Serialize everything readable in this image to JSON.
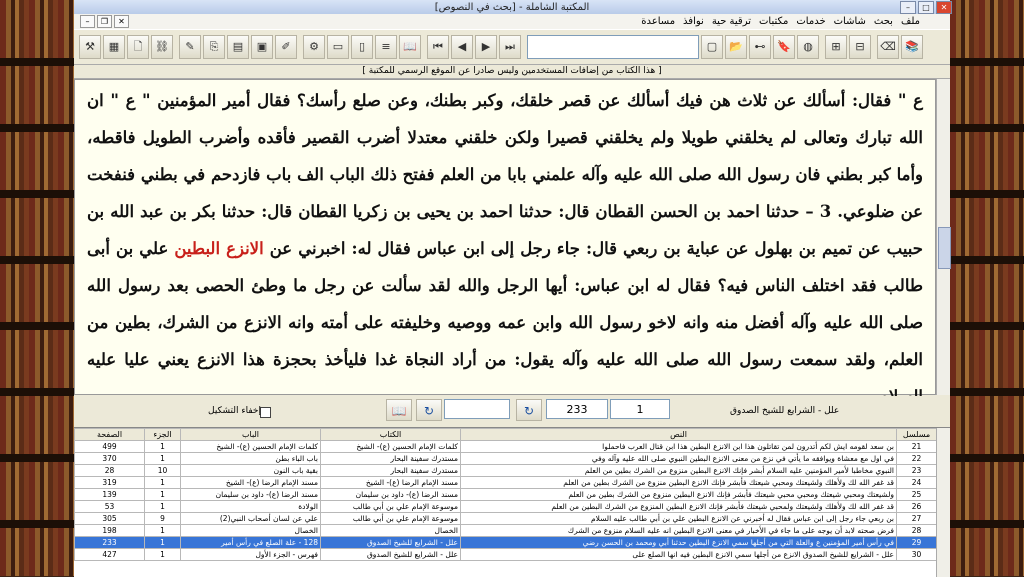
{
  "window_title": "المكتبة الشاملة - [بحث في النصوص]",
  "menu": [
    "ملف",
    "بحث",
    "شاشات",
    "خدمات",
    "مكتبات",
    "ترقية حية",
    "نوافذ",
    "مساعدة"
  ],
  "notice": "[ هذا الكتاب من إضافات المستخدمين وليس صادرا عن الموقع الرسمي للمكتبة ]",
  "reader": {
    "p1": "ع \" فقال: أسألك عن ثلاث هن فيك أسألك عن قصر خلقك، وكبر بطنك، وعن صلع رأسك؟ فقال أمير المؤمنين \" ع \" ان الله تبارك وتعالى لم يخلقني طويلا ولم يخلقني قصيرا ولكن خلقني معتدلا أضرب القصير فأقده وأضرب الطويل فاقطه، وأما كبر بطني فان رسول الله صلى الله عليه وآله علمني بابا من العلم ففتح ذلك الباب الف باب فازدحم في بطني فنفخت عن ضلوعي. 3 – حدثنا احمد بن الحسن القطان قال: حدثنا احمد بن يحيى بن زكريا القطان قال: حدثنا بكر بن عبد الله بن حبيب عن تميم بن بهلول عن عباية بن ربعي قال: جاء رجل إلى ابن عباس فقال له: اخبرني عن",
    "highlight": "الانزع البطين",
    "p2": " علي بن أبى طالب فقد اختلف الناس فيه؟ فقال له ابن عباس: أيها الرجل والله لقد سألت عن رجل ما وطئ الحصى بعد رسول الله صلى الله عليه وآله أفضل منه وانه لاخو رسول الله وابن عمه ووصيه وخليفته على أمته وانه الانزع من الشرك، بطين من العلم، ولقد سمعت رسول الله صلى الله عليه وآله يقول: من أراد النجاة غدا فليأخذ بحجزة هذا الانزع يعني عليا عليه السلام."
  },
  "search": {
    "book_label": "علل - الشرايع للشيخ الصدوق",
    "field_part": "1",
    "field_page": "233",
    "hide_label": "إخفاء التشكيل"
  },
  "table": {
    "headers": [
      "مسلسل",
      "النص",
      "الكتاب",
      "الباب",
      "الجزء",
      "الصفحة"
    ],
    "rows": [
      [
        "21",
        "بن سعد لقومه ايش لكم أتدرون لمن تقاتلون هذا ابن الانزع البطين هذا ابن قتال العرب فاحملوا",
        "كلمات الإمام الحسين (ع)- الشيخ",
        "كلمات الإمام الحسين (ع)- الشيخ",
        "1",
        "499"
      ],
      [
        "22",
        "في اول مع معشاة ويوافقه ما يأتي في نزع من معنى الانزع البطين النبوي صلى الله عليه وآله وفي",
        "مستدرك سفينة البحار",
        "باب الباء بطن",
        "1",
        "370"
      ],
      [
        "23",
        "النبوي مخاطبا لأمير المؤمنين عليه السلام أبشر فإنك الانزع البطين منزوع من الشرك بطين من العلم",
        "مستدرك سفينة البحار",
        "بقية باب النون",
        "10",
        "28"
      ],
      [
        "24",
        "قد غفر الله لك ولأهلك ولشيعتك ومحبي شيعتك فأبشر فإنك الانزع البطين منزوع من الشرك بطين من العلم",
        "مسند الإمام الرضا (ع)- الشيخ",
        "مسند الإمام الرضا (ع)- الشيخ",
        "1",
        "319"
      ],
      [
        "25",
        "ولشيعتك ومحبي شيعتك ومحبي محبي شيعتك فأبشر فإنك الانزع البطين منزوع من الشرك بطين من العلم",
        "مسند الرضا (ع)- داود بن سليمان",
        "مسند الرضا (ع)- داود بن سليمان",
        "1",
        "139"
      ],
      [
        "26",
        "قد غفر الله لك ولأهلك ولشيعتك ولمحبي شيعتك فأبشر فإنك الانزع البطين المنزوع من الشرك البطين من العلم",
        "موسوعة الإمام علي بن أبي طالب",
        "الولادة",
        "1",
        "53"
      ],
      [
        "27",
        "بن ربعي جاء رجل إلى ابن عباس فقال له أخبرني عن الانزع البطين علي بن أبي طالب عليه السلام",
        "موسوعة الإمام علي بن أبي طالب",
        "علي عن لسان أصحاب النبي(2)",
        "9",
        "305"
      ],
      [
        "28",
        "فرض صحته لابد أن يوجه على ما جاء في الأخبار في معنى الانزع البطين انه عليه السلام منزوع من الشرك",
        "الخصال",
        "الخصال",
        "1",
        "198"
      ],
      [
        "29",
        "في رأس أمير المؤمنين ع والعلة التي من أجلها سمي الانزع البطين حدثنا أبي ومحمد بن الحسن رضي",
        "علل - الشرايع للشيخ الصدوق",
        "128 - علة الصلع في رأس أمير",
        "1",
        "233"
      ],
      [
        "30",
        "علل - الشرايع للشيخ الصدوق الانزع من أجلها سمي الانزع البطين فيه انها الصلع على",
        "علل - الشرايع للشيخ الصدوق",
        "فهرس - الجزء الأول",
        "1",
        "427"
      ]
    ],
    "selected_index": 8
  },
  "toolbar_icons": [
    "tools-icon",
    "grid-icon",
    "new-doc-icon",
    "link-icon",
    "sep",
    "edit-doc-icon",
    "copy-icon",
    "doc-icon",
    "image-icon",
    "pen-icon",
    "sep",
    "settings-icon",
    "doc-gray-icon",
    "copy-gray-icon",
    "lines-icon",
    "book-icon",
    "sep",
    "first-icon",
    "prev-icon",
    "next-icon",
    "last-icon",
    "sep",
    "combo",
    "window-icon",
    "open-folder-icon",
    "binoculars-icon",
    "bookmark-icon",
    "globe-icon",
    "sep",
    "tree-icon",
    "network-icon",
    "sep",
    "eraser-icon",
    "library-icon"
  ]
}
